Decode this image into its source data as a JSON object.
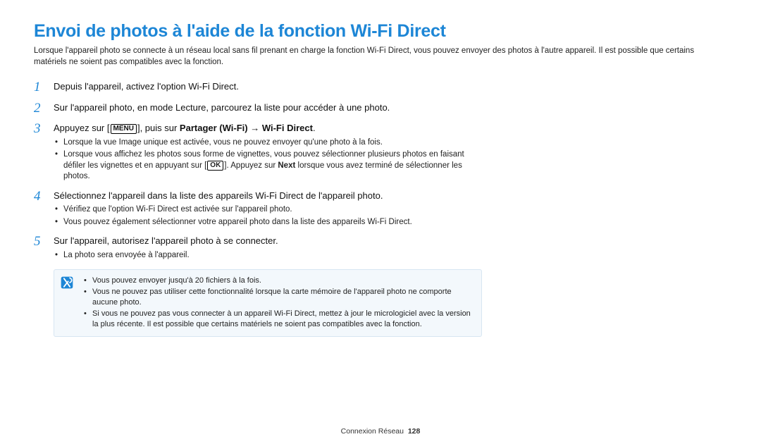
{
  "title": "Envoi de photos à l'aide de la fonction Wi-Fi Direct",
  "intro": "Lorsque l'appareil photo se connecte à un réseau local sans fil prenant en charge la fonction Wi-Fi Direct, vous pouvez envoyer des photos à l'autre appareil. Il est possible que certains matériels ne soient pas compatibles avec la fonction.",
  "steps": [
    {
      "num": "1",
      "text": "Depuis l'appareil, activez l'option Wi-Fi Direct."
    },
    {
      "num": "2",
      "text": "Sur l'appareil photo, en mode Lecture, parcourez la liste pour accéder à une photo."
    },
    {
      "num": "3",
      "pre": "Appuyez sur [",
      "kbd1": "MENU",
      "mid": "], puis sur ",
      "bold": "Partager (Wi‑Fi) → Wi‑Fi Direct",
      "post": ".",
      "sub": [
        "Lorsque la vue Image unique est activée, vous ne pouvez envoyer qu'une photo à la fois.",
        {
          "pre": "Lorsque vous affichez les photos sous forme de vignettes, vous pouvez sélectionner plusieurs photos en faisant défiler les vignettes et en appuyant sur [",
          "kbd": "OK",
          "mid": "]. Appuyez sur ",
          "bold": "Next",
          "post": " lorsque vous avez terminé de sélectionner les photos."
        }
      ]
    },
    {
      "num": "4",
      "text": "Sélectionnez l'appareil dans la liste des appareils Wi‑Fi Direct de l'appareil photo.",
      "sub": [
        "Vérifiez que l'option Wi‑Fi Direct est activée sur l'appareil photo.",
        "Vous pouvez également sélectionner votre appareil photo dans la liste des appareils Wi‑Fi Direct."
      ]
    },
    {
      "num": "5",
      "text": "Sur l'appareil, autorisez l'appareil photo à se connecter.",
      "sub": [
        "La photo sera envoyée à l'appareil."
      ]
    }
  ],
  "note": [
    "Vous pouvez envoyer jusqu'à 20 fichiers à la fois.",
    "Vous ne pouvez pas utiliser cette fonctionnalité lorsque la carte mémoire de l'appareil photo ne comporte aucune photo.",
    "Si vous ne pouvez pas vous connecter à un appareil Wi‑Fi Direct, mettez à jour le micrologiciel avec la version la plus récente. Il est possible que certains matériels ne soient pas compatibles avec la fonction."
  ],
  "footer": {
    "section": "Connexion Réseau",
    "page": "128"
  }
}
